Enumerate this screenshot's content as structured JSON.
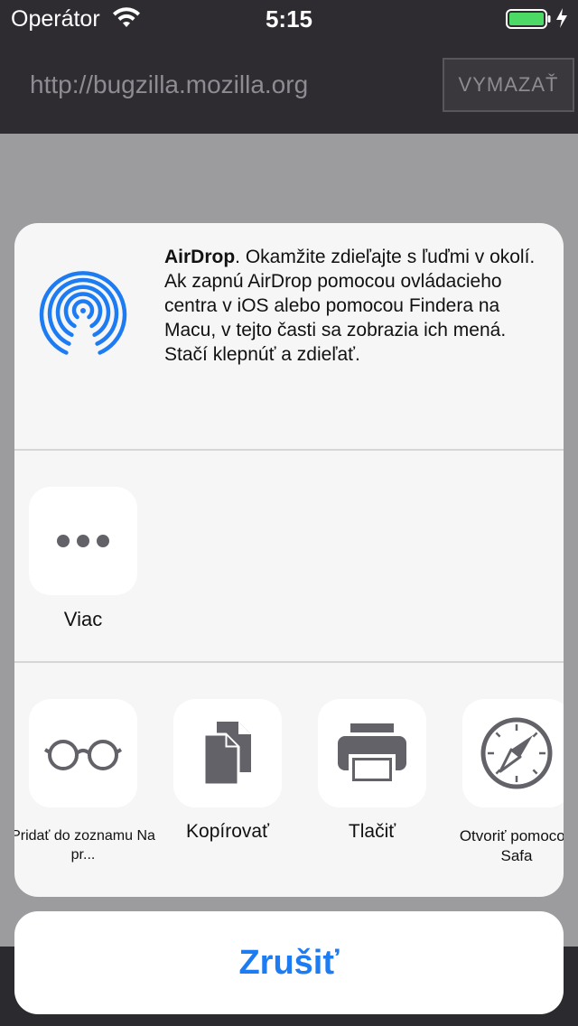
{
  "status_bar": {
    "carrier": "Operátor",
    "time": "5:15"
  },
  "browser": {
    "url": "http://bugzilla.mozilla.org",
    "clear_label": "VYMAZAŤ"
  },
  "share_sheet": {
    "airdrop": {
      "title": "AirDrop",
      "description": ". Okamžite zdieľajte s ľuďmi v okolí. Ak zapnú AirDrop pomocou ovládacieho centra v iOS alebo pomocou Findera na Macu, v tejto časti sa zobrazia ich mená. Stačí klepnúť a zdieľať."
    },
    "more": {
      "label": "Viac"
    },
    "actions": [
      {
        "label": "Pridať do zoznamu Na pr...",
        "icon": "reading-list-glasses-icon"
      },
      {
        "label": "Kopírovať",
        "icon": "copy-icon"
      },
      {
        "label": "Tlačiť",
        "icon": "print-icon"
      },
      {
        "label": "Otvoriť pomocou Safa",
        "icon": "safari-compass-icon"
      }
    ],
    "cancel_label": "Zrušiť"
  },
  "colors": {
    "accent": "#1e7cf2",
    "icon_gray": "#636268",
    "battery_green": "#4cd964"
  }
}
